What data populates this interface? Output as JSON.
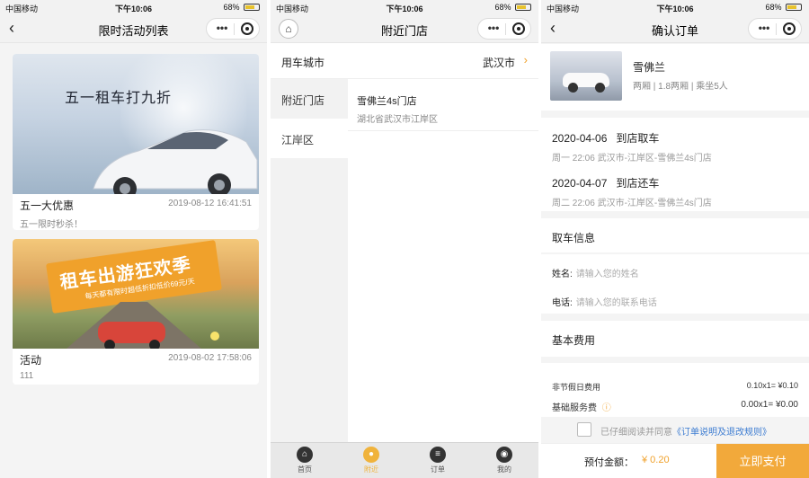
{
  "status_bar": {
    "carrier": "中国移动",
    "time": "下午10:06",
    "battery": "68%",
    "battery_level": 0.68
  },
  "screen1": {
    "title": "限时活动列表",
    "cards": [
      {
        "banner_text": "五一租车打九折",
        "title": "五一大优惠",
        "date": "2019-08-12 16:41:51",
        "desc": "五一限时秒杀！"
      },
      {
        "banner_text": "租车出游狂欢季",
        "banner_sub": "每天都有限时超低折扣低价69元/天",
        "title": "活动",
        "date": "2019-08-02 17:58:06",
        "desc": "111"
      }
    ]
  },
  "screen2": {
    "title": "附近门店",
    "city_label": "用车城市",
    "city_value": "武汉市",
    "left_items": [
      "附近门店",
      "江岸区"
    ],
    "store_name": "雪佛兰4s门店",
    "store_address": "湖北省武汉市江岸区",
    "tabs": [
      {
        "label": "首页",
        "icon": "home-icon"
      },
      {
        "label": "附近",
        "icon": "location-icon"
      },
      {
        "label": "订单",
        "icon": "order-icon"
      },
      {
        "label": "我的",
        "icon": "user-icon"
      }
    ],
    "active_tab": 1,
    "accent_color": "#f0b33c"
  },
  "screen3": {
    "title": "确认订单",
    "car_name": "雪佛兰",
    "car_spec": "两厢 | 1.8两厢 | 乘坐5人",
    "pickup": {
      "date": "2020-04-06",
      "action": "到店取车",
      "detail": "周一 22:06   武汉市-江岸区-雪佛兰4s门店"
    },
    "return": {
      "date": "2020-04-07",
      "action": "到店还车",
      "detail": "周二 22:06   武汉市-江岸区-雪佛兰4s门店"
    },
    "pickup_info_title": "取车信息",
    "name_label": "姓名:",
    "name_placeholder": "请输入您的姓名",
    "phone_label": "电话:",
    "phone_placeholder": "请输入您的联系电话",
    "fee_title": "基本费用",
    "fees": [
      {
        "label": "非节假日费用",
        "value": "0.10x1= ¥0.10"
      },
      {
        "label": "基础服务费",
        "value": "0.00x1= ¥0.00"
      }
    ],
    "agree_text": "已仔细阅读并同意",
    "agree_link": "《订单说明及退改规则》",
    "total_label": "预付金额：",
    "total_value": "¥ 0.20",
    "pay_button": "立即支付",
    "accent_color": "#f2a93b"
  }
}
